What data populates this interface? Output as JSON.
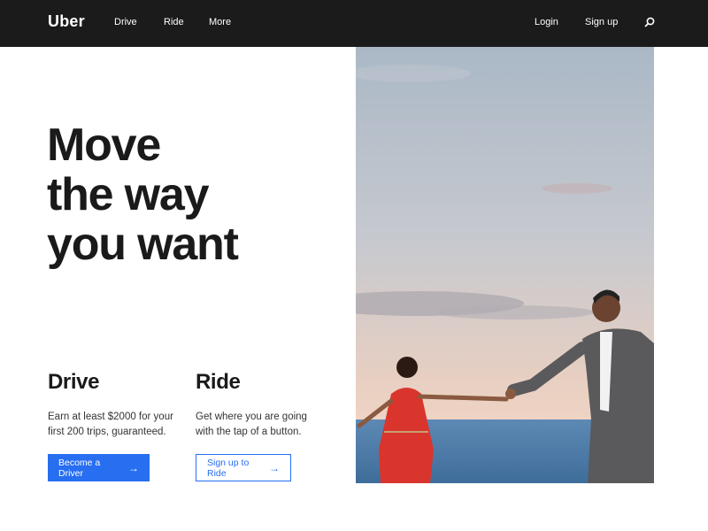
{
  "nav": {
    "logo": "Uber",
    "links": [
      "Drive",
      "Ride",
      "More"
    ],
    "login": "Login",
    "signup": "Sign up"
  },
  "hero": {
    "lines": [
      "Move",
      "the way",
      "you want"
    ]
  },
  "drive": {
    "heading": "Drive",
    "text": "Earn at least $2000 for your first 200 trips, guaranteed.",
    "button": "Become a Driver"
  },
  "ride": {
    "heading": "Ride",
    "text": "Get where you are going with the tap of a button.",
    "button": "Sign up to Ride"
  },
  "icons": {
    "search": "search-icon",
    "arrow": "arrow-right-icon"
  },
  "colors": {
    "nav_bg": "#1b1b1b",
    "accent": "#276ef1"
  }
}
